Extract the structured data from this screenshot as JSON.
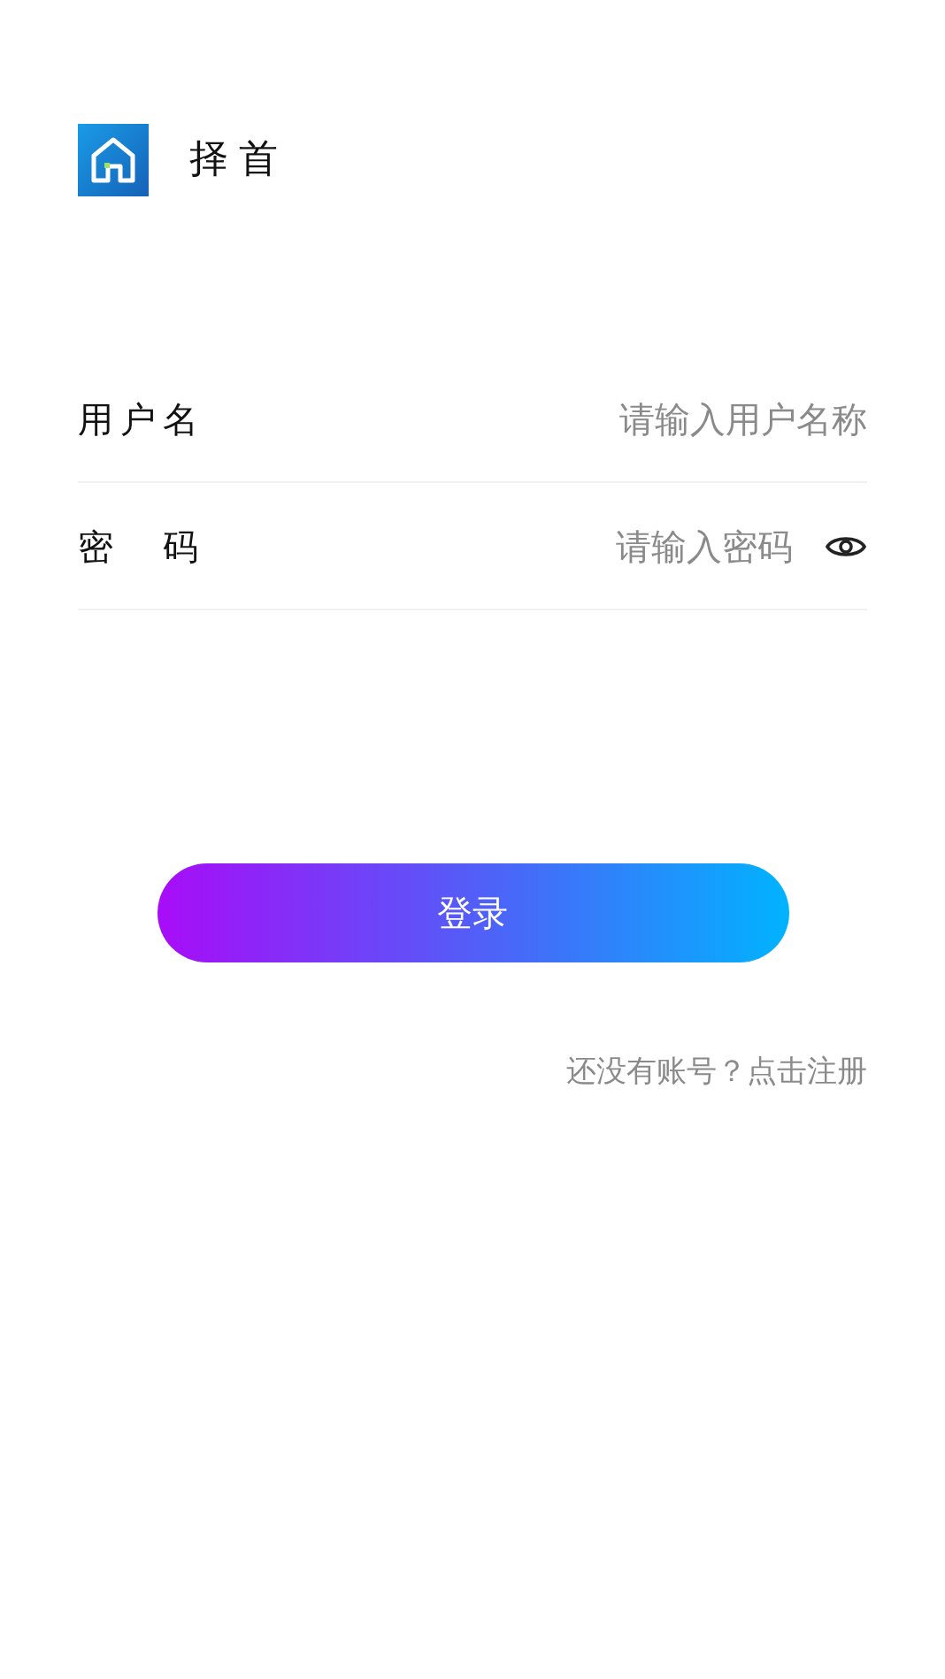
{
  "app": {
    "name": "择首"
  },
  "fields": [
    {
      "label": "用户名",
      "placeholder": "请输入用户名称",
      "kind": "text"
    },
    {
      "label": "密　码",
      "placeholder": "请输入密码",
      "kind": "password"
    }
  ],
  "login_button": "登录",
  "register_link": "还没有账号？点击注册"
}
